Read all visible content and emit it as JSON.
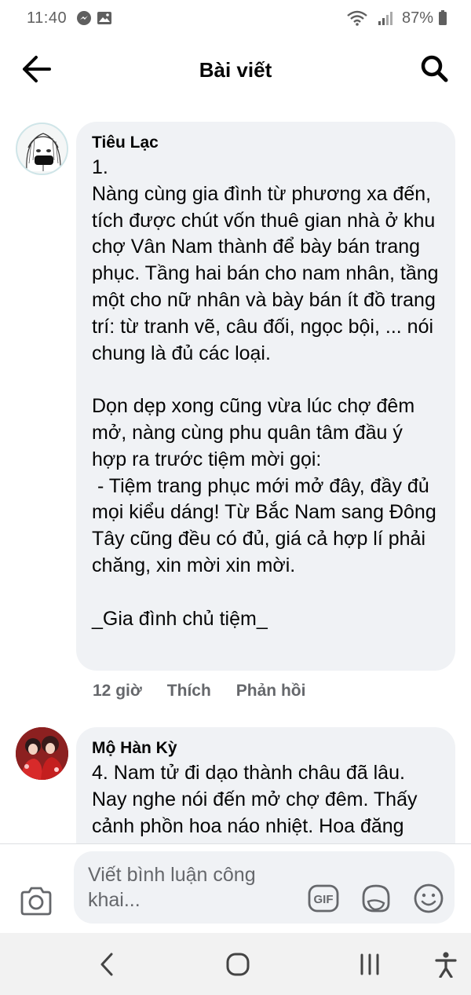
{
  "status_bar": {
    "time": "11:40",
    "battery": "87%",
    "icons": [
      "messenger-icon",
      "gallery-icon",
      "wifi-icon",
      "signal-icon",
      "battery-icon"
    ]
  },
  "header": {
    "title": "Bài viết",
    "icons": [
      "back-arrow-icon",
      "search-icon"
    ]
  },
  "comments": [
    {
      "author": "Tiêu Lạc",
      "text": "1.\nNàng cùng gia đình từ phương xa đến, tích được chút vốn thuê gian nhà ở khu chợ Vân Nam thành để bày bán trang phục. Tầng hai bán cho nam nhân, tầng một cho nữ nhân và bày bán ít đồ trang trí: từ tranh vẽ, câu đối, ngọc bội, ... nói chung là đủ các loại.\n\nDọn dẹp xong cũng vừa lúc chợ đêm mở, nàng cùng phu quân tâm đầu ý hợp ra trước tiệm mời gọi:\n - Tiệm trang phục mới mở đây, đầy đủ mọi kiểu dáng! Từ Bắc Nam sang Đông Tây cũng đều có đủ, giá cả hợp lí phải chăng, xin mời xin mời.\n\n_Gia đình chủ tiệm_",
      "time": "12 giờ",
      "like_label": "Thích",
      "reply_label": "Phản hồi"
    },
    {
      "author": "Mộ Hàn Kỳ",
      "text": "4. Nam tử đi dạo thành châu đã lâu. Nay nghe nói đến mở chợ đêm. Thấy cảnh phồn hoa náo nhiệt. Hoa đăng"
    }
  ],
  "composer": {
    "placeholder": "Viết bình luận công khai...",
    "gif_label": "GIF",
    "icons": [
      "camera-icon",
      "gif-icon",
      "sticker-icon",
      "emoji-icon"
    ]
  },
  "nav_bar": {
    "icons": [
      "back-nav-icon",
      "home-nav-icon",
      "recents-nav-icon",
      "accessibility-icon"
    ]
  },
  "colors": {
    "bubble_bg": "#f0f2f5",
    "secondary_text": "#65676b",
    "primary_text": "#050505",
    "nav_bg": "#f2f2f2"
  }
}
